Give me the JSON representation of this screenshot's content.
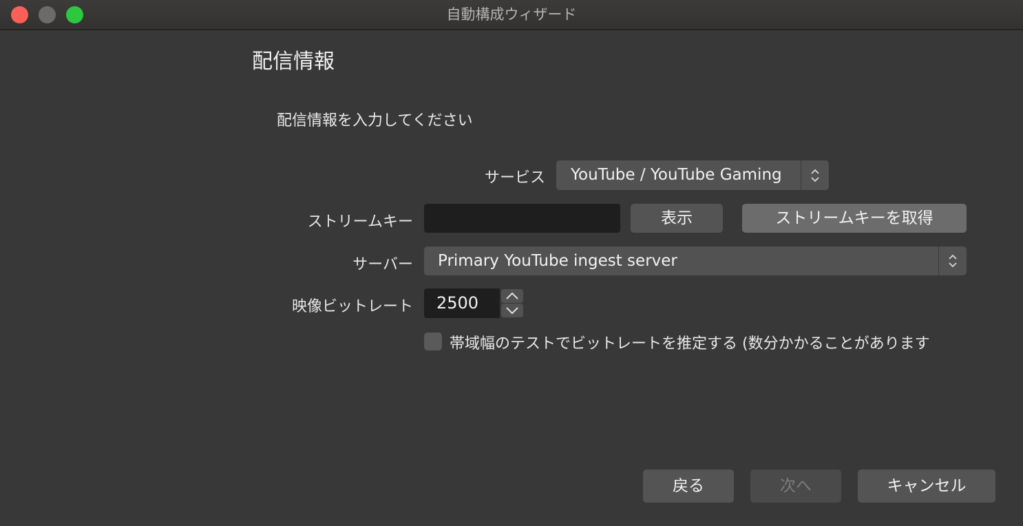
{
  "window": {
    "title": "自動構成ウィザード"
  },
  "page": {
    "title": "配信情報",
    "subtitle": "配信情報を入力してください"
  },
  "form": {
    "service": {
      "label": "サービス",
      "value": "YouTube / YouTube Gaming"
    },
    "stream_key": {
      "label": "ストリームキー",
      "value": "",
      "show_label": "表示",
      "get_key_label": "ストリームキーを取得"
    },
    "server": {
      "label": "サーバー",
      "value": "Primary YouTube ingest server"
    },
    "bitrate": {
      "label": "映像ビットレート",
      "value": "2500"
    },
    "bandwidth_test": {
      "label": "帯域幅のテストでビットレートを推定する (数分かかることがあります",
      "checked": false
    }
  },
  "footer": {
    "back_label": "戻る",
    "next_label": "次へ",
    "cancel_label": "キャンセル"
  },
  "colors": {
    "close": "#fe5f57",
    "minimize": "#6d6b6a",
    "maximize": "#2bc840",
    "background": "#383838"
  }
}
